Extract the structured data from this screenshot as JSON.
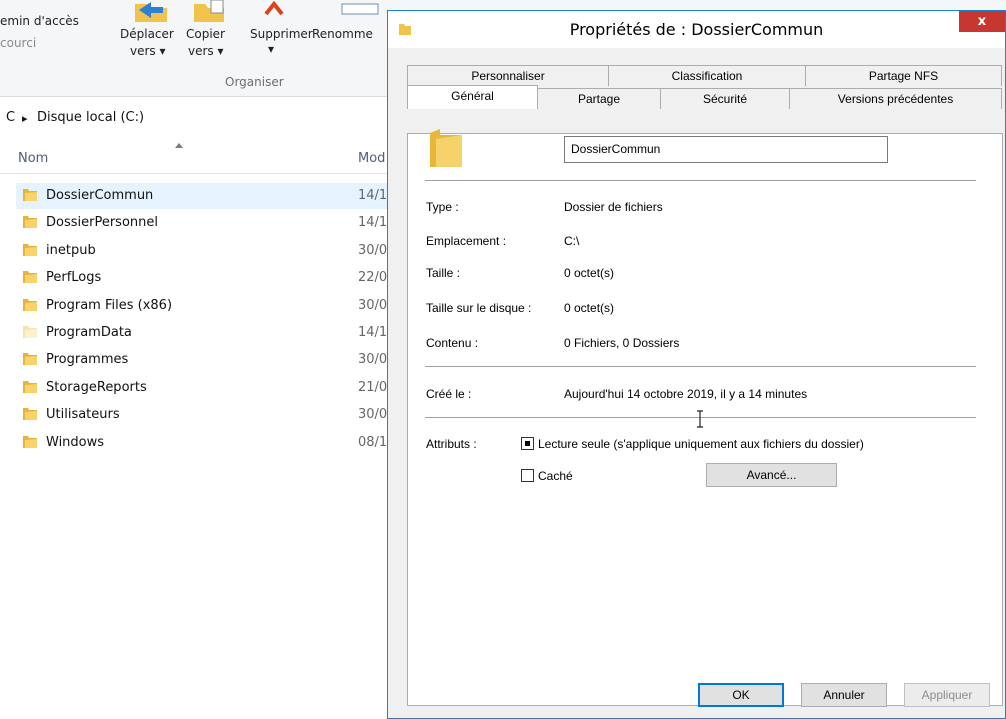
{
  "ribbon": {
    "items": [
      {
        "label": "Déplacer",
        "sub": "vers ▾"
      },
      {
        "label": "Copier",
        "sub": "vers ▾"
      },
      {
        "label": "Supprimer",
        "sub": "▾"
      },
      {
        "label": "Renomme"
      }
    ],
    "left_text_1": "emin d'accès",
    "left_text_2": "courci",
    "group_label": "Organiser"
  },
  "address": {
    "prefix": "C",
    "separator": "▸",
    "location": "Disque local (C:)"
  },
  "file_list": {
    "columns": [
      "Nom",
      "Mod"
    ],
    "rows": [
      {
        "name": "DossierCommun",
        "date": "14/1",
        "selected": true
      },
      {
        "name": "DossierPersonnel",
        "date": "14/1"
      },
      {
        "name": "inetpub",
        "date": "30/0"
      },
      {
        "name": "PerfLogs",
        "date": "22/0"
      },
      {
        "name": "Program Files (x86)",
        "date": "30/0"
      },
      {
        "name": "ProgramData",
        "date": "14/1",
        "faded": true
      },
      {
        "name": "Programmes",
        "date": "30/0"
      },
      {
        "name": "StorageReports",
        "date": "21/0"
      },
      {
        "name": "Utilisateurs",
        "date": "30/0"
      },
      {
        "name": "Windows",
        "date": "08/1"
      }
    ]
  },
  "dialog": {
    "title": "Propriétés de : DossierCommun",
    "close_label": "x",
    "tabs_row1": [
      "Personnaliser",
      "Classification",
      "Partage NFS"
    ],
    "tabs_row2": [
      "Général",
      "Partage",
      "Sécurité",
      "Versions précédentes"
    ],
    "active_tab": "Général",
    "folder_name": "DossierCommun",
    "properties": [
      {
        "label": "Type :",
        "value": "Dossier de fichiers"
      },
      {
        "label": "Emplacement :",
        "value": "C:\\"
      },
      {
        "label": "Taille :",
        "value": "0 octet(s)"
      },
      {
        "label": "Taille sur le disque :",
        "value": "0 octet(s)"
      },
      {
        "label": "Contenu :",
        "value": "0 Fichiers, 0 Dossiers"
      }
    ],
    "created": {
      "label": "Créé le :",
      "value": "Aujourd'hui 14 octobre 2019, il y a 14 minutes"
    },
    "attributes": {
      "label": "Attributs :",
      "readonly_label": "Lecture seule (s'applique uniquement aux fichiers du dossier)",
      "readonly_state": "indeterminate",
      "hidden_label": "Caché",
      "hidden_state": "unchecked",
      "advanced_button": "Avancé..."
    },
    "buttons": {
      "ok": "OK",
      "cancel": "Annuler",
      "apply": "Appliquer"
    }
  },
  "colors": {
    "selection": "#e5f3ff",
    "dialog_border": "#1883d7",
    "close_button": "#c7372f",
    "folder_yellow": "#f0c44c",
    "header_text": "#4c607a"
  }
}
